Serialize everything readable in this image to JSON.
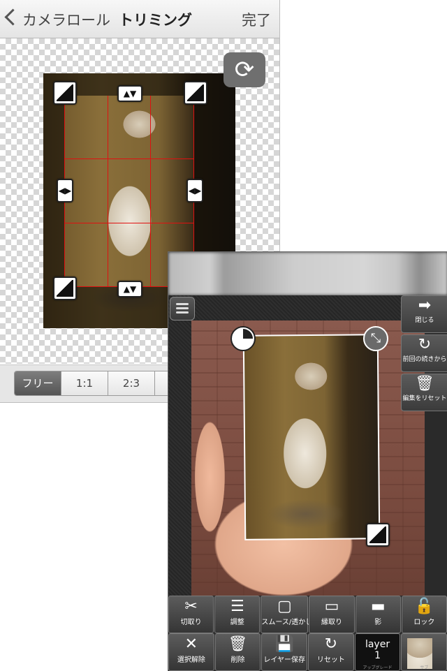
{
  "trim_screen": {
    "back_label": "カメラロール",
    "title": "トリミング",
    "done_label": "完了",
    "ratio_options": [
      "フリー",
      "1:1",
      "2:3",
      ""
    ],
    "selected_ratio": "フリー"
  },
  "editor": {
    "side_buttons": [
      {
        "label": "閉じる",
        "icon": "arrow-right-icon"
      },
      {
        "label": "前回の続きから",
        "icon": "refresh-icon"
      },
      {
        "label": "編集をリセット",
        "icon": "trash-icon"
      }
    ],
    "toolbar_top": [
      {
        "label": "切取り",
        "icon": "scissors-icon"
      },
      {
        "label": "調整",
        "icon": "sliders-icon"
      },
      {
        "label": "スムース/透かし",
        "icon": "rounded-rect-icon"
      },
      {
        "label": "縁取り",
        "icon": "outlined-rect-icon"
      },
      {
        "label": "影",
        "icon": "shadow-rect-icon"
      },
      {
        "label": "ロック",
        "icon": "unlock-icon"
      }
    ],
    "toolbar_bottom": [
      {
        "label": "選択解除",
        "icon": "close-icon"
      },
      {
        "label": "削除",
        "icon": "trash-icon"
      },
      {
        "label": "レイヤー保存",
        "icon": "save-icon"
      },
      {
        "label": "リセット",
        "icon": "refresh-icon"
      }
    ],
    "layer_button": {
      "title": "layer",
      "number": "1",
      "caption": "アップグレード"
    },
    "thumb_caption": "サブ"
  }
}
